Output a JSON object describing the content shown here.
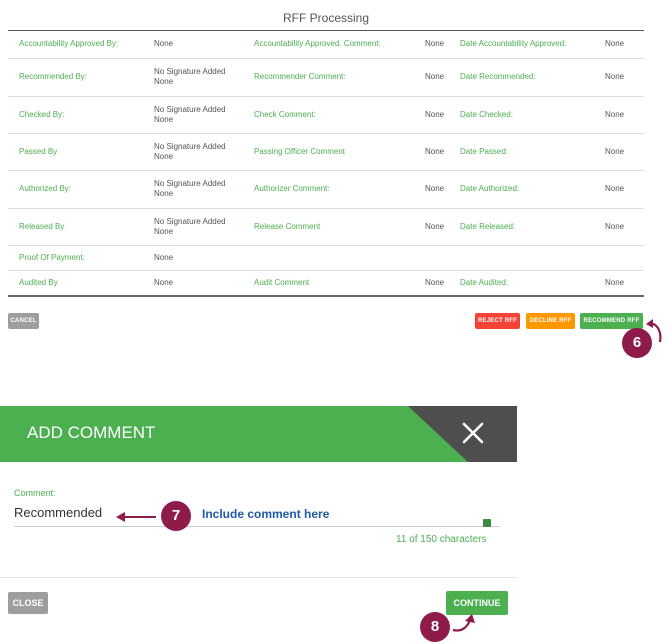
{
  "rff": {
    "title": "RFF Processing",
    "rows": [
      {
        "l1": "Accountability Approved By:",
        "v1": "None",
        "l2": "Accountability Approved. Comment:",
        "v2": "None",
        "l3": "Date Accountability Approved:",
        "v3": "None"
      },
      {
        "l1": "Recommended By:",
        "v1": "No Signature Added\nNone",
        "l2": "Recommender Comment:",
        "v2": "None",
        "l3": "Date Recommended:",
        "v3": "None"
      },
      {
        "l1": "Checked By:",
        "v1": "No Signature Added\nNone",
        "l2": "Check Comment:",
        "v2": "None",
        "l3": "Date Checked:",
        "v3": "None"
      },
      {
        "l1": "Passed By",
        "v1": "No Signature Added\nNone",
        "l2": "Passing Officer Comment",
        "v2": "None",
        "l3": "Date Passed:",
        "v3": "None"
      },
      {
        "l1": "Authorized By:",
        "v1": "No Signature Added\nNone",
        "l2": "Authorizer Comment:",
        "v2": "None",
        "l3": "Date Authorized:",
        "v3": "None"
      },
      {
        "l1": "Released By",
        "v1": "No Signature Added\nNone",
        "l2": "Release Comment",
        "v2": "None",
        "l3": "Date Released:",
        "v3": "None"
      },
      {
        "l1": "Proof Of Payment:",
        "v1": "None",
        "l2": "",
        "v2": "",
        "l3": "",
        "v3": ""
      },
      {
        "l1": "Audited By",
        "v1": "None",
        "l2": "Audit Comment",
        "v2": "None",
        "l3": "Date Audited:",
        "v3": "None"
      }
    ],
    "buttons": {
      "cancel": "CANCEL",
      "reject": "REJECT RFF",
      "decline": "DECLINE RFF",
      "recommend": "RECOMMEND RFF"
    }
  },
  "dialog": {
    "title": "ADD COMMENT",
    "comment_label": "Comment:",
    "comment_value": "Recommended",
    "counter": "11 of 150 characters",
    "close_label": "CLOSE",
    "continue_label": "CONTINUE"
  },
  "annotations": {
    "step6": "6",
    "step7": "7",
    "step8": "8",
    "hint": "Include comment here"
  },
  "colors": {
    "green": "#4caf50",
    "dark": "#4e4e4e",
    "red": "#f44336",
    "orange": "#ff9800",
    "badge": "#8e1b4a",
    "hint": "#1e5aa8"
  }
}
